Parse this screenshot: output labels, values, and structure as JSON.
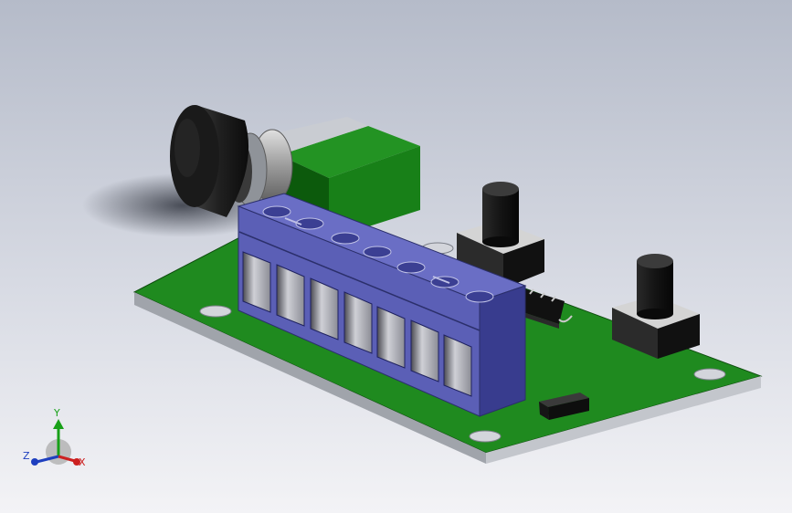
{
  "view": {
    "background_top": "#b5bbc9",
    "background_bottom": "#f3f3f6"
  },
  "model": {
    "pcb_color": "#1f8a1f",
    "terminal_block_color": "#5b5fb6",
    "terminal_count": 7,
    "potentiometer_body_color": "#1e1e1e",
    "pushbutton_count": 2,
    "ic_pin_count_visible": 4,
    "mounting_hole_count": 4
  },
  "triad": {
    "y_label": "Y",
    "z_label": "Z",
    "x_label": "X",
    "y_color": "#18a018",
    "z_color": "#1e3fbf",
    "x_color": "#cc2020"
  }
}
